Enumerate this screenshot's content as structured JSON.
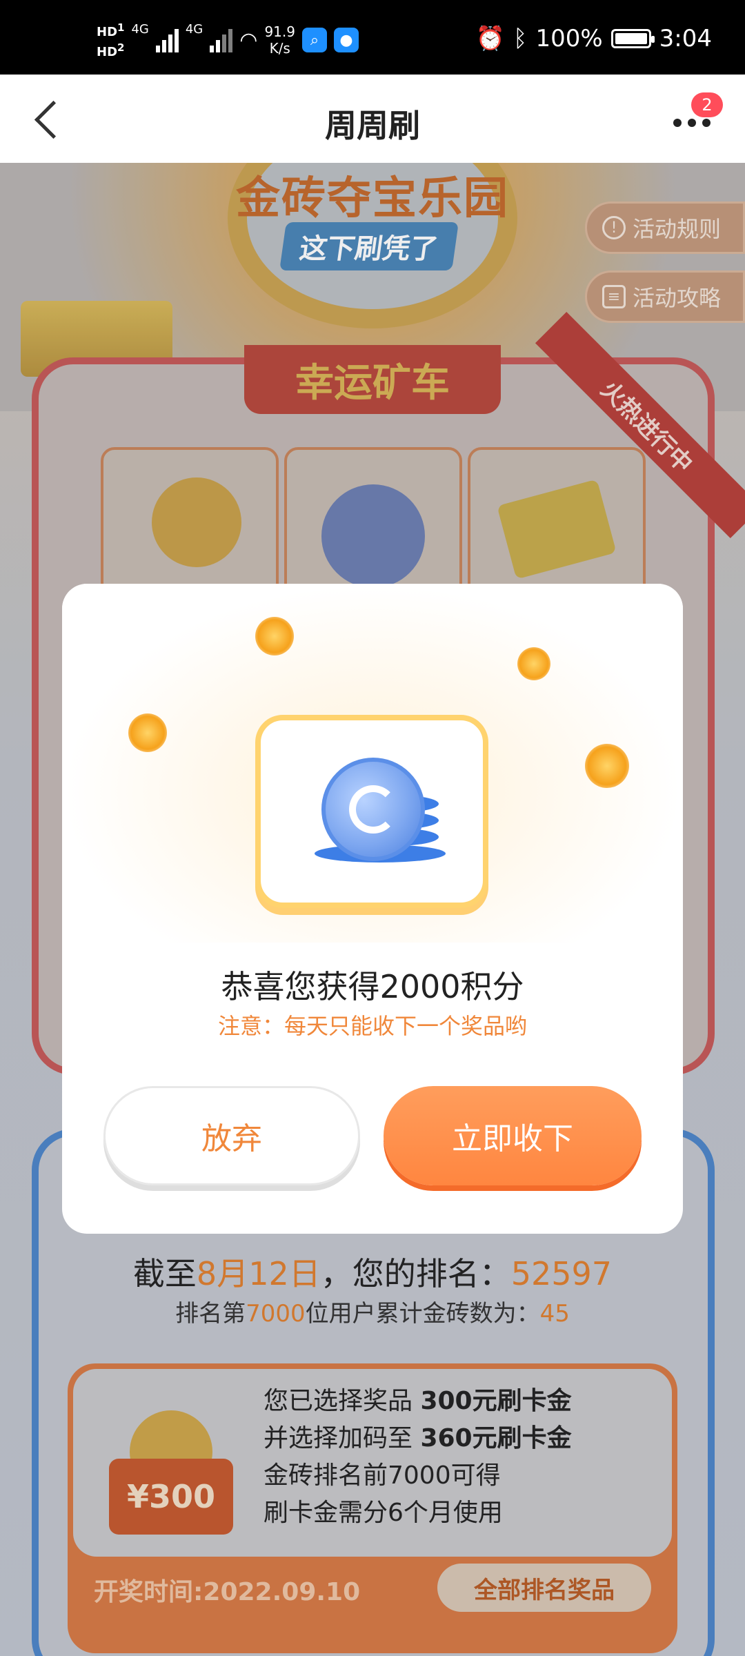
{
  "status_bar": {
    "hd1": "HD",
    "hd1_sub": "1",
    "hd2": "HD",
    "hd2_sub": "2",
    "net1": "4G",
    "net2": "4G",
    "speed_value": "91.9",
    "speed_unit": "K/s",
    "battery": "100%",
    "time": "3:04"
  },
  "nav": {
    "title": "周周刷",
    "badge_count": "2"
  },
  "background": {
    "hero_title": "金砖夺宝乐园",
    "hero_subtitle": "这下刷凭了",
    "rules_label": "活动规则",
    "guide_label": "活动攻略",
    "card_title": "幸运矿车",
    "ribbon_label": "火热进行中",
    "rank_prefix": "截至",
    "rank_date": "8月12日",
    "rank_middle": "，您的排名：",
    "rank_value": "52597",
    "rank_sub_prefix": "排名第",
    "rank_sub_num": "7000",
    "rank_sub_middle": "位用户累计金砖数为：",
    "rank_sub_value": "45",
    "selection": {
      "badge_amount": "¥300",
      "line1_prefix": "您已选择奖品 ",
      "line1_value": "300元刷卡金",
      "line2_prefix": "并选择加码至 ",
      "line2_value": "360元刷卡金",
      "line3": "金砖排名前7000可得",
      "line4": "刷卡金需分6个月使用"
    },
    "draw_time": "开奖时间:2022.09.10",
    "all_prizes_button": "全部排名奖品"
  },
  "modal": {
    "title": "恭喜您获得2000积分",
    "note": "注意：每天只能收下一个奖品哟",
    "abandon_button": "放弃",
    "accept_button": "立即收下"
  }
}
